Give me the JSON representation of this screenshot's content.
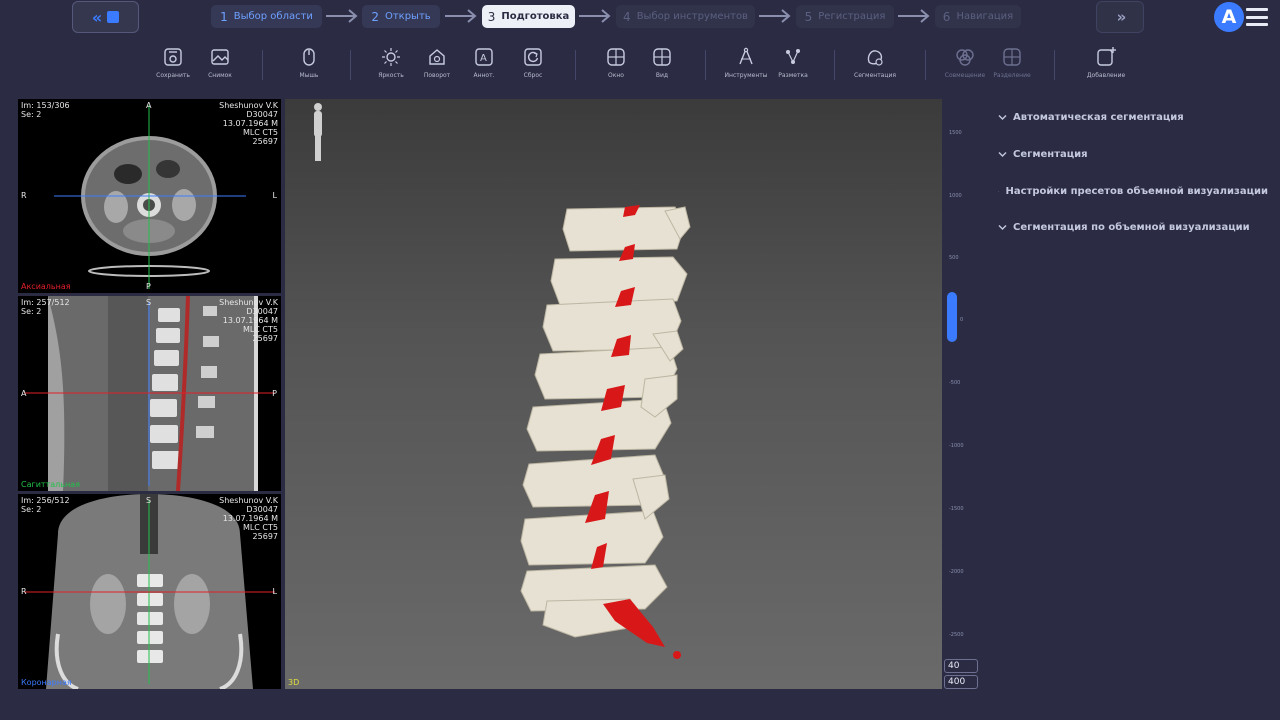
{
  "wizard": {
    "steps": [
      {
        "num": "1",
        "label": "Выбор области"
      },
      {
        "num": "2",
        "label": "Открыть"
      },
      {
        "num": "3",
        "label": "Подготовка"
      },
      {
        "num": "4",
        "label": "Выбор инструментов"
      },
      {
        "num": "5",
        "label": "Регистрация"
      },
      {
        "num": "6",
        "label": "Навигация"
      }
    ],
    "active_step": 3
  },
  "logo": {
    "letter": "A"
  },
  "toolbar": {
    "save": "Сохранить",
    "snapshot": "Снимок",
    "mouse": "Мышь",
    "brightness": "Яркость",
    "rotate": "Поворот",
    "annotation": "Аннот.",
    "reset": "Сброс",
    "window": "Окно",
    "view": "Вид",
    "instruments": "Инструменты",
    "markup": "Разметка",
    "segmentation": "Сегментация",
    "merge": "Совмещение",
    "split": "Разделение",
    "add": "Добавление"
  },
  "viewports": {
    "axial": {
      "im": "Im: 153/306",
      "se": "Se: 2",
      "patient": "Sheshunov V.K",
      "id": "D30047",
      "dob": "13.07.1964 M",
      "device": "MLC CT5",
      "num": "25697",
      "top": "A",
      "bottom": "P",
      "left": "R",
      "right": "L",
      "name": "Аксиальная",
      "name_color": "#e0202a"
    },
    "sagittal": {
      "im": "Im: 257/512",
      "se": "Se: 2",
      "patient": "Sheshunov V.K",
      "id": "D30047",
      "dob": "13.07.1964 M",
      "device": "MLC CT5",
      "num": "25697",
      "top": "S",
      "left": "A",
      "right": "P",
      "name": "Сагиттальная",
      "name_color": "#22c04a"
    },
    "coronal": {
      "im": "Im: 256/512",
      "se": "Se: 2",
      "patient": "Sheshunov V.K",
      "id": "D30047",
      "dob": "13.07.1964 M",
      "device": "MLC CT5",
      "num": "25697",
      "top": "S",
      "left": "R",
      "right": "L",
      "name": "Коронарная",
      "name_color": "#3b7bff"
    },
    "volume": {
      "name": "3D"
    }
  },
  "ruler": {
    "ticks": [
      "1500",
      "1000",
      "500",
      "0",
      "-500",
      "-1000",
      "-1500",
      "-2000",
      "-2500"
    ],
    "window_level": "40",
    "window_width": "400"
  },
  "panels": [
    "Автоматическая сегментация",
    "Сегментация",
    "Настройки пресетов объемной визуализации",
    "Сегментация по объемной визуализации"
  ],
  "colors": {
    "accent": "#3b7bff",
    "background": "#2b2c43",
    "segmentation_red": "#d81818",
    "bone": "#e6e1d2"
  }
}
